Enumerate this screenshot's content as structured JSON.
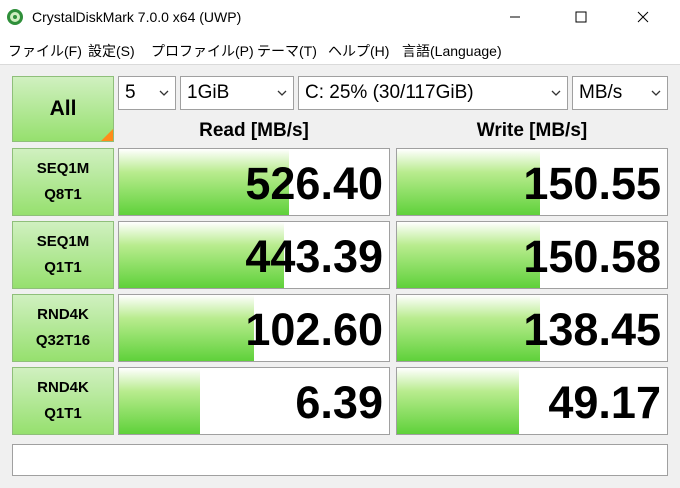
{
  "window": {
    "title": "CrystalDiskMark 7.0.0 x64 (UWP)"
  },
  "menu": [
    "ファイル(F)",
    "設定(S)",
    "プロファイル(P)",
    "テーマ(T)",
    "ヘルプ(H)",
    "言語(Language)"
  ],
  "controls": {
    "all_label": "All",
    "count": "5",
    "size": "1GiB",
    "drive": "C: 25% (30/117GiB)",
    "unit": "MB/s"
  },
  "headers": {
    "read": "Read [MB/s]",
    "write": "Write [MB/s]"
  },
  "tests": [
    {
      "line1": "SEQ1M",
      "line2": "Q8T1",
      "read": "526.40",
      "write": "150.55",
      "read_fill": 0.63,
      "write_fill": 0.53
    },
    {
      "line1": "SEQ1M",
      "line2": "Q1T1",
      "read": "443.39",
      "write": "150.58",
      "read_fill": 0.61,
      "write_fill": 0.53
    },
    {
      "line1": "RND4K",
      "line2": "Q32T16",
      "read": "102.60",
      "write": "138.45",
      "read_fill": 0.5,
      "write_fill": 0.53
    },
    {
      "line1": "RND4K",
      "line2": "Q1T1",
      "read": "6.39",
      "write": "49.17",
      "read_fill": 0.3,
      "write_fill": 0.45
    }
  ],
  "status": "",
  "colors": {
    "button_green": "#96e06e",
    "bar_green": "#5fd13a",
    "corner_orange": "#ff8c1a"
  }
}
